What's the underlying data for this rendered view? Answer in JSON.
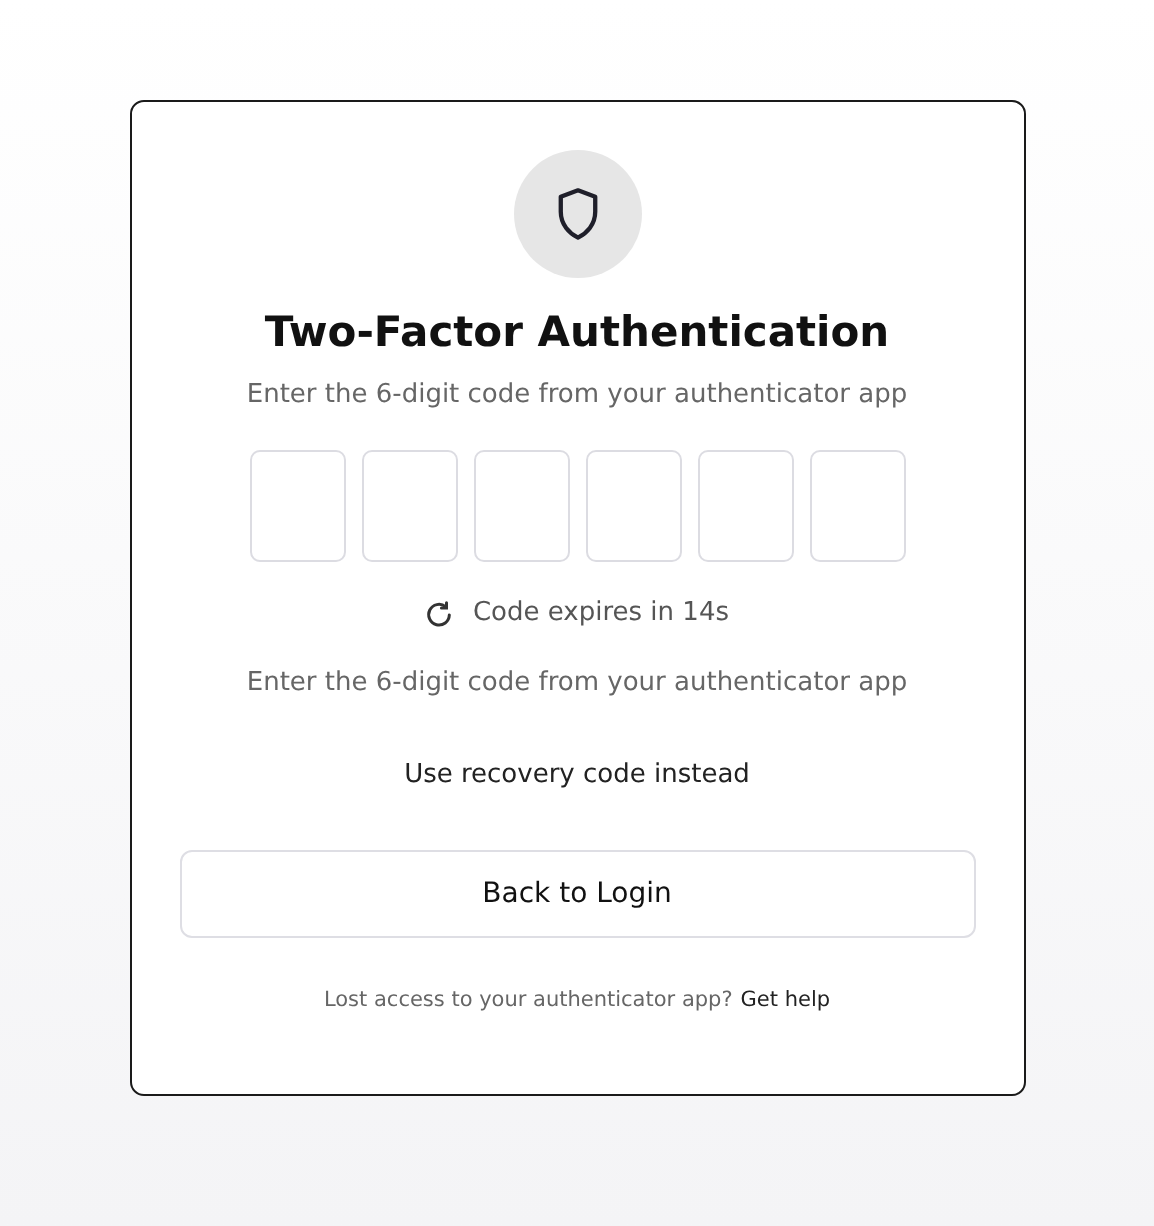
{
  "card": {
    "title": "Two-Factor Authentication",
    "subtitle": "Enter the 6-digit code from your authenticator app",
    "code_fields": [
      {
        "kind": "digit"
      },
      {
        "kind": "digit"
      },
      {
        "kind": "digit"
      },
      {
        "kind": "digit"
      },
      {
        "kind": "digit"
      },
      {
        "kind": "digit"
      }
    ],
    "timer": "Code expires in 14s",
    "hint": "Enter the 6-digit code from your authenticator app",
    "recovery_link": "Use recovery code instead",
    "back_button": "Back to Login",
    "footer": {
      "text": "Lost access to your authenticator app?",
      "link": "Get help"
    }
  }
}
